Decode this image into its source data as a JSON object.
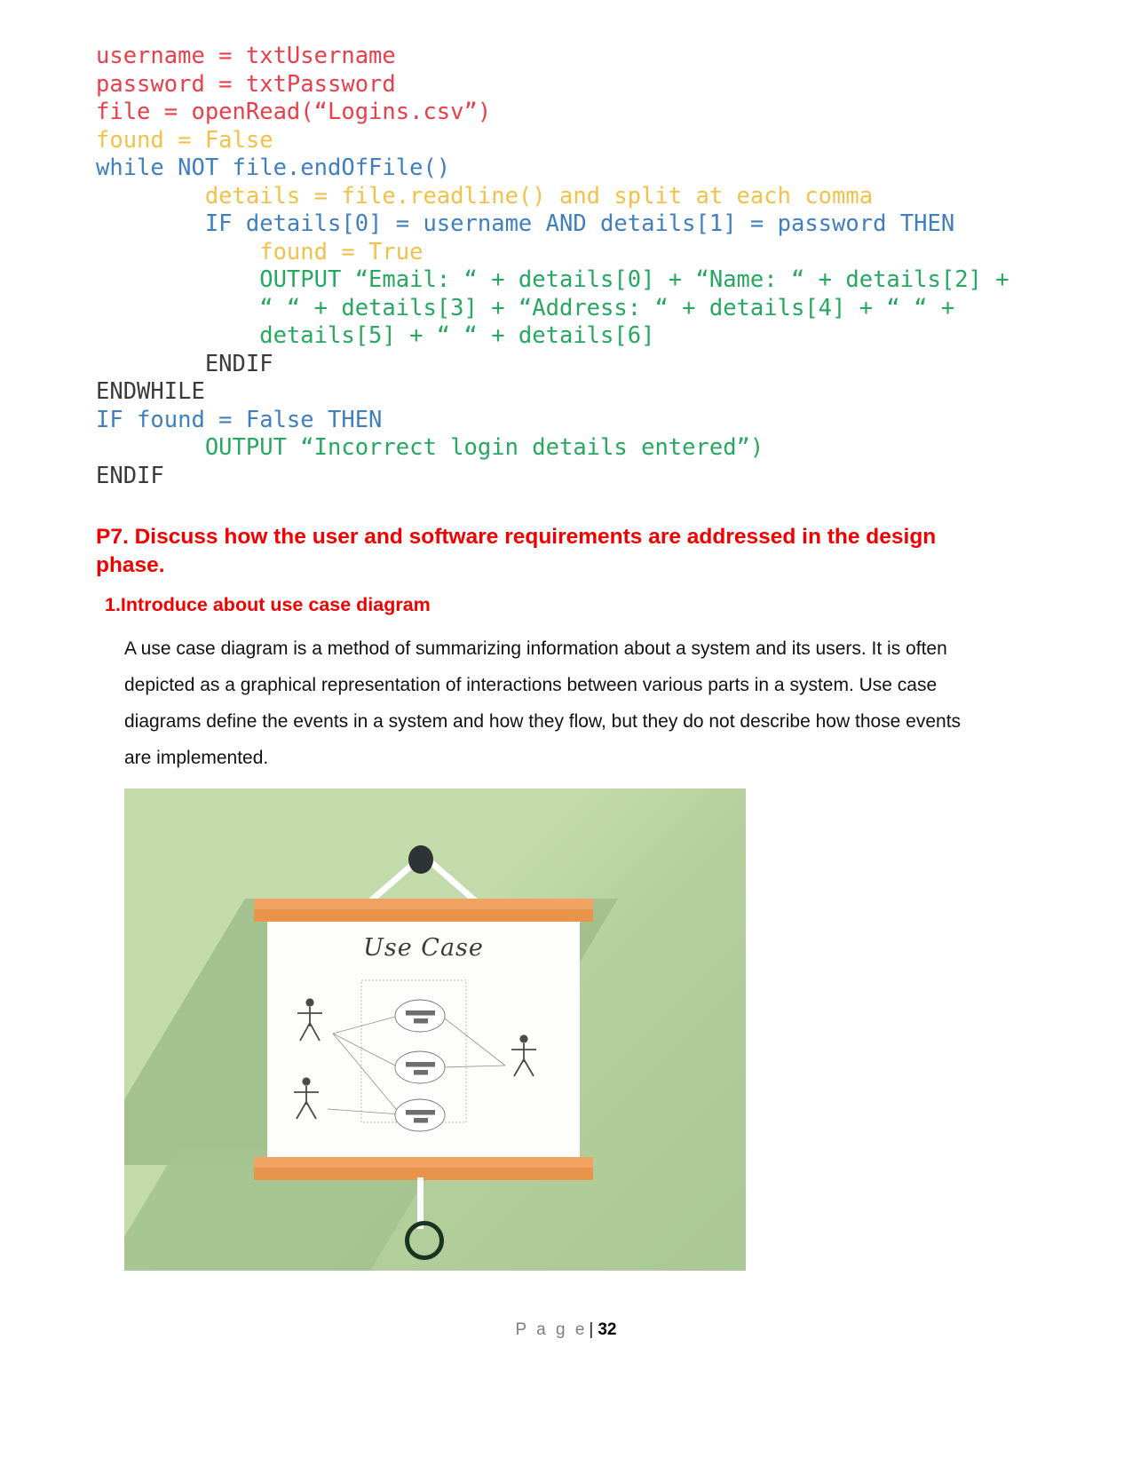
{
  "document": {
    "page_label_word": "P a g e",
    "page_separator": "|",
    "page_number": "32"
  },
  "code_block": {
    "language": "pseudocode",
    "lines": [
      {
        "indent": 0,
        "color": "red",
        "text": "username = txtUsername"
      },
      {
        "indent": 0,
        "color": "red",
        "text": "password = txtPassword"
      },
      {
        "indent": 0,
        "color": "red",
        "text": "file = openRead(“Logins.csv”)"
      },
      {
        "indent": 0,
        "color": "yellow",
        "text": "found = False"
      },
      {
        "indent": 0,
        "color": "blue",
        "text": "while NOT file.endOfFile()"
      },
      {
        "indent": 2,
        "color": "yellow",
        "text": "details = file.readline() and split at each comma"
      },
      {
        "indent": 2,
        "color": "blue",
        "text": "IF details[0] = username AND details[1] = password THEN"
      },
      {
        "indent": 3,
        "color": "yellow",
        "text": "found = True"
      },
      {
        "indent": 3,
        "color": "green",
        "text": "OUTPUT “Email: “ + details[0] + “Name: “ + details[2] +"
      },
      {
        "indent": 3,
        "color": "green",
        "text": "“ “ + details[3] + “Address: “ + details[4] + “ “ +"
      },
      {
        "indent": 3,
        "color": "green",
        "text": "details[5] + “ “ + details[6]"
      },
      {
        "indent": 2,
        "color": "dark",
        "text": "ENDIF"
      },
      {
        "indent": 0,
        "color": "dark",
        "text": "ENDWHILE"
      },
      {
        "indent": 0,
        "color": "blue",
        "text": "IF found = False THEN"
      },
      {
        "indent": 2,
        "color": "green",
        "text": "OUTPUT “Incorrect login details entered”)"
      },
      {
        "indent": 0,
        "color": "dark",
        "text": "ENDIF"
      }
    ],
    "colors": {
      "red": "#e8404a",
      "yellow": "#f2c14a",
      "blue": "#3f7fc0",
      "green": "#27a860",
      "dark": "#3a3a3a"
    }
  },
  "section": {
    "heading": "P7. Discuss how the user and software requirements are addressed in the design phase.",
    "heading_color": "#f20000",
    "subheading": "1.Introduce about use case diagram",
    "paragraph": "A use case diagram is a method of summarizing information about a system and its users. It is often depicted as a graphical representation of interactions between various parts in a system. Use case diagrams define the events in a system and how they flow, but they do not describe how those events are implemented."
  },
  "illustration": {
    "alt": "use-case-diagram-poster",
    "poster_title": "Use Case",
    "background_color": "#b4cf9b",
    "bar_color": "#e8944b",
    "poster_color": "#fdfdfb",
    "hook_color": "#2d3436",
    "actors_count": 3,
    "use_cases_count": 3
  }
}
